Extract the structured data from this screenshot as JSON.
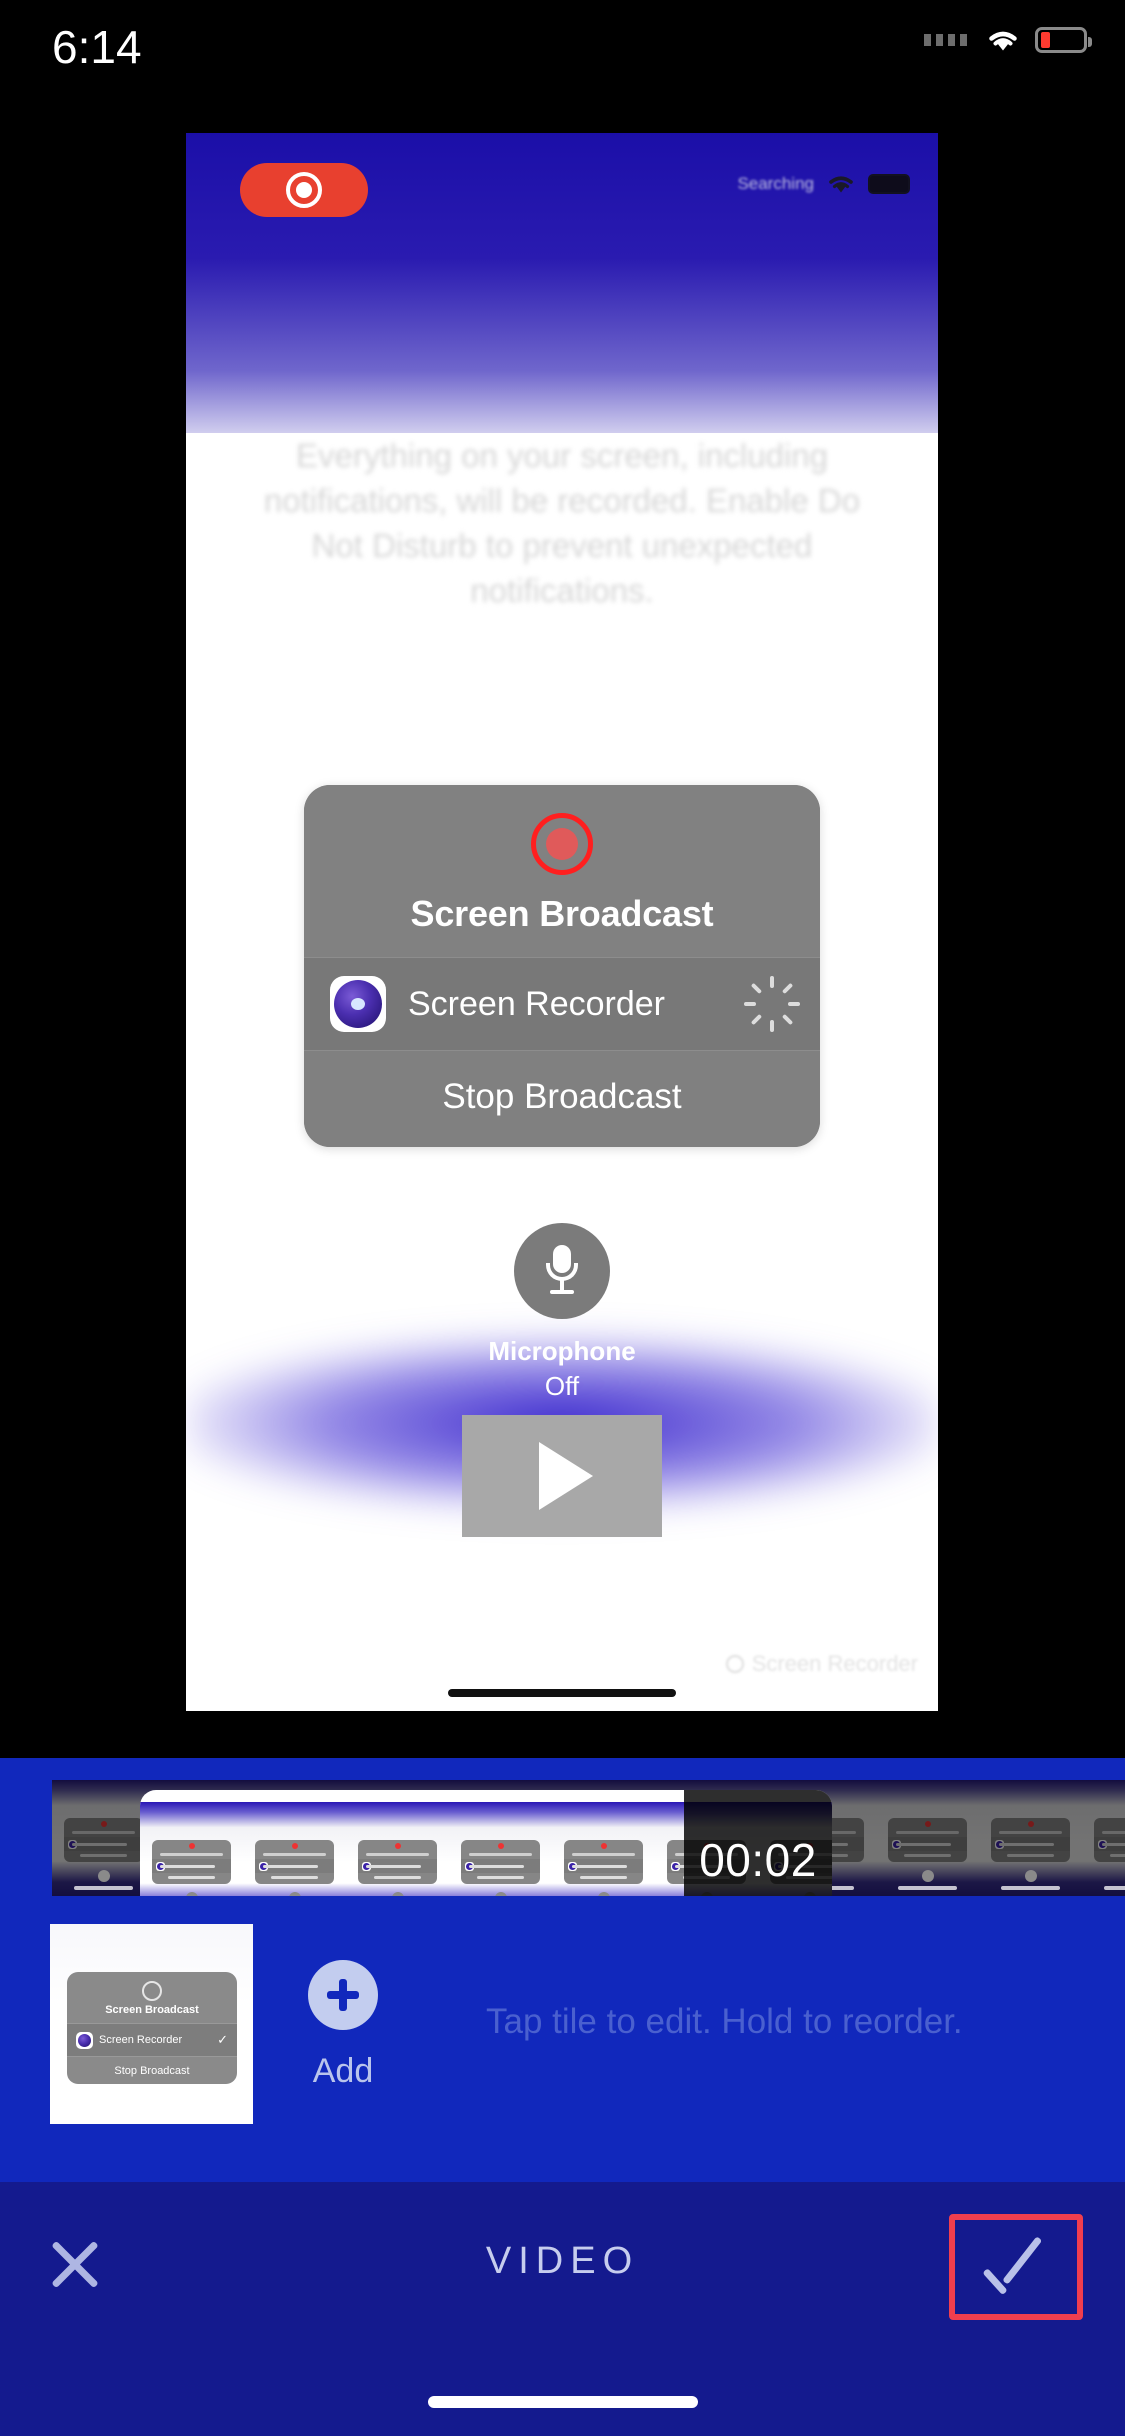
{
  "device_status_bar": {
    "time": "6:14",
    "wifi_icon": "wifi-icon",
    "battery_icon": "battery-low-icon",
    "signal_icon": "signal-dots-icon"
  },
  "preview": {
    "recording_pill_icon": "record-icon",
    "carrier_text": "Searching",
    "notice_text": "Everything on your screen, including notifications, will be recorded. Enable Do Not Disturb to prevent unexpected notifications.",
    "dialog": {
      "record_icon": "record-circle-icon",
      "title": "Screen Broadcast",
      "app_row": {
        "app_icon": "screen-recorder-app-icon",
        "label": "Screen Recorder",
        "status_icon": "spinner-icon"
      },
      "footer_action": "Stop Broadcast"
    },
    "microphone": {
      "icon": "microphone-icon",
      "label": "Microphone",
      "state": "Off"
    },
    "play_button_icon": "play-icon",
    "watermark": {
      "icon": "screen-recorder-badge-icon",
      "text": "Screen Recorder"
    }
  },
  "editor": {
    "timeline": {
      "duration_badge": "00:02",
      "selection_handle_icon": "trim-handle-icon"
    },
    "tile": {
      "thumbnail_dialog": {
        "record_icon": "record-circle-icon",
        "title": "Screen Broadcast",
        "app_icon": "screen-recorder-app-icon",
        "app_label": "Screen Recorder",
        "check_icon": "✓",
        "footer_action": "Stop Broadcast"
      }
    },
    "add_button": {
      "icon": "plus-icon",
      "label": "Add"
    },
    "hint_text": "Tap tile to edit. Hold to reorder."
  },
  "toolbar": {
    "close_icon": "close-x-icon",
    "title": "VIDEO",
    "confirm_icon": "check-icon",
    "home_indicator": "home-indicator"
  },
  "colors": {
    "editor_blue": "#1128bc",
    "toolbar_blue": "#141a8e",
    "record_red": "#e8402f",
    "highlight_red": "#f03e4e",
    "hint_blue": "#4a60cf",
    "add_circle": "#c3cdef"
  }
}
